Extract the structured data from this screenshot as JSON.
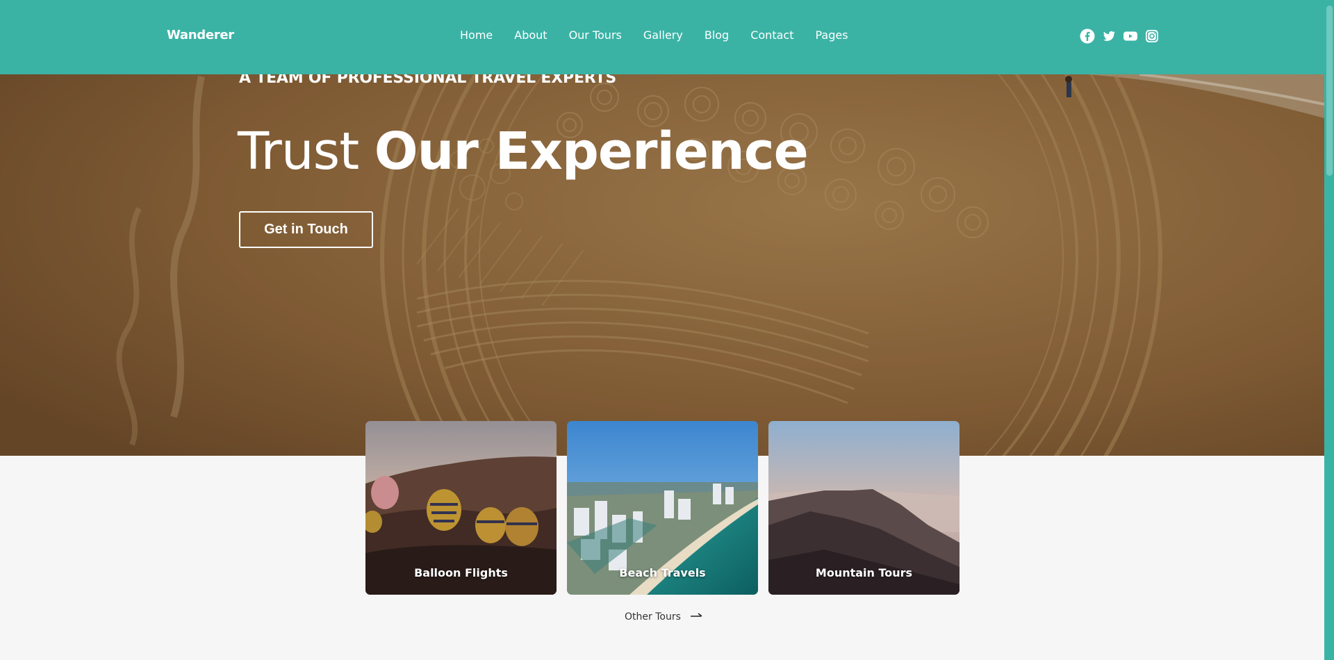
{
  "header": {
    "brand": "Wanderer",
    "nav": [
      "Home",
      "About",
      "Our Tours",
      "Gallery",
      "Blog",
      "Contact",
      "Pages"
    ],
    "social_icons": [
      "facebook-icon",
      "twitter-icon",
      "youtube-icon",
      "instagram-icon"
    ]
  },
  "hero": {
    "eyebrow": "A TEAM OF PROFESSIONAL TRAVEL EXPERTS",
    "headline_light": "Trust",
    "headline_bold": "Our Experience",
    "cta_label": "Get in Touch"
  },
  "tours": {
    "cards": [
      {
        "title": "Balloon Flights"
      },
      {
        "title": "Beach Travels"
      },
      {
        "title": "Mountain Tours"
      }
    ],
    "other_link": "Other Tours"
  },
  "colors": {
    "header_bg": "#3ab3a5",
    "page_bg": "#f6f6f6",
    "text_light": "#ffffff"
  }
}
